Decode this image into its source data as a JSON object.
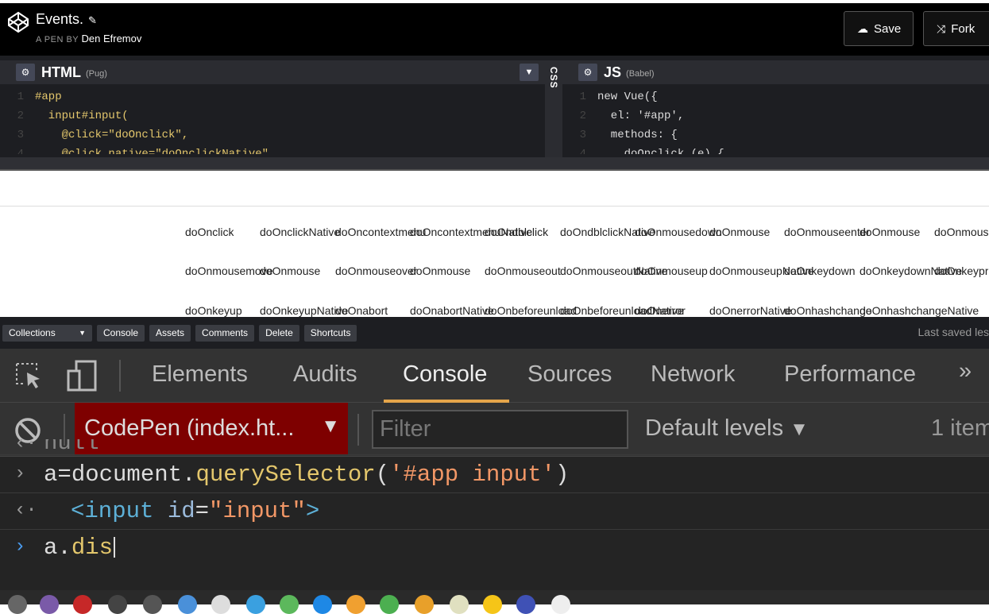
{
  "header": {
    "pen_title": "Events.",
    "pen_by_label": "A PEN BY",
    "author": "Den Efremov",
    "save_label": "Save",
    "fork_label": "Fork"
  },
  "html_pane": {
    "title": "HTML",
    "subtitle": "(Pug)",
    "lines": [
      {
        "n": "1",
        "code": "#app"
      },
      {
        "n": "2",
        "code": "  input#input("
      },
      {
        "n": "3",
        "code": "    @click=\"doOnclick\","
      },
      {
        "n": "4",
        "code": "    @click.native=\"doOnclickNative\""
      }
    ]
  },
  "css_pane": {
    "title": "CSS"
  },
  "js_pane": {
    "title": "JS",
    "subtitle": "(Babel)",
    "lines": [
      {
        "n": "1",
        "code": "new Vue({"
      },
      {
        "n": "2",
        "code": "  el: '#app',"
      },
      {
        "n": "3",
        "code": "  methods: {"
      },
      {
        "n": "4",
        "code": "    doOnclick (e) {"
      }
    ]
  },
  "preview": {
    "rows": [
      [
        "doOnclick",
        "doOnclickNative",
        "doOncontextmenu",
        "doOncontextmenuNative",
        "doOndblclick",
        "doOndblclickNative",
        "doOnmousedown",
        "doOnmouse",
        "doOnmouseenter",
        "doOnmouse",
        "doOnmous"
      ],
      [
        "doOnmousemove",
        "doOnmouse",
        "doOnmouseover",
        "doOnmouse",
        "doOnmouseout",
        "doOnmouseoutNative",
        "doOnmouseup",
        "doOnmouseupNative",
        "doOnkeydown",
        "doOnkeydownNative",
        "doOnkeypr"
      ],
      [
        "doOnkeyup",
        "doOnkeyupNative",
        "doOnabort",
        "doOnabortNative",
        "doOnbeforeunload",
        "doOnbeforeunloadNative",
        "doOnerror",
        "doOnerrorNative",
        "doOnhashchange",
        "doOnhashchangeNative"
      ]
    ]
  },
  "bottom_bar": {
    "collections": "Collections",
    "console": "Console",
    "assets": "Assets",
    "comments": "Comments",
    "delete": "Delete",
    "shortcuts": "Shortcuts",
    "last_saved": "Last saved les"
  },
  "devtools": {
    "tabs": [
      "Elements",
      "Audits",
      "Console",
      "Sources",
      "Network",
      "Performance"
    ],
    "more": "»",
    "context": "CodePen (index.ht...",
    "filter_placeholder": "Filter",
    "levels": "Default levels",
    "items": "1 item",
    "console_lines": {
      "prev": "null",
      "input1_var": "a",
      "input1_obj": "document.",
      "input1_fn": "querySelector",
      "input1_arg": "'#app input'",
      "output_tag_open": "<input",
      "output_attr": "id",
      "output_val": "\"input\"",
      "output_tag_close": ">",
      "current_obj": "a.",
      "current_typed": "dis"
    }
  }
}
